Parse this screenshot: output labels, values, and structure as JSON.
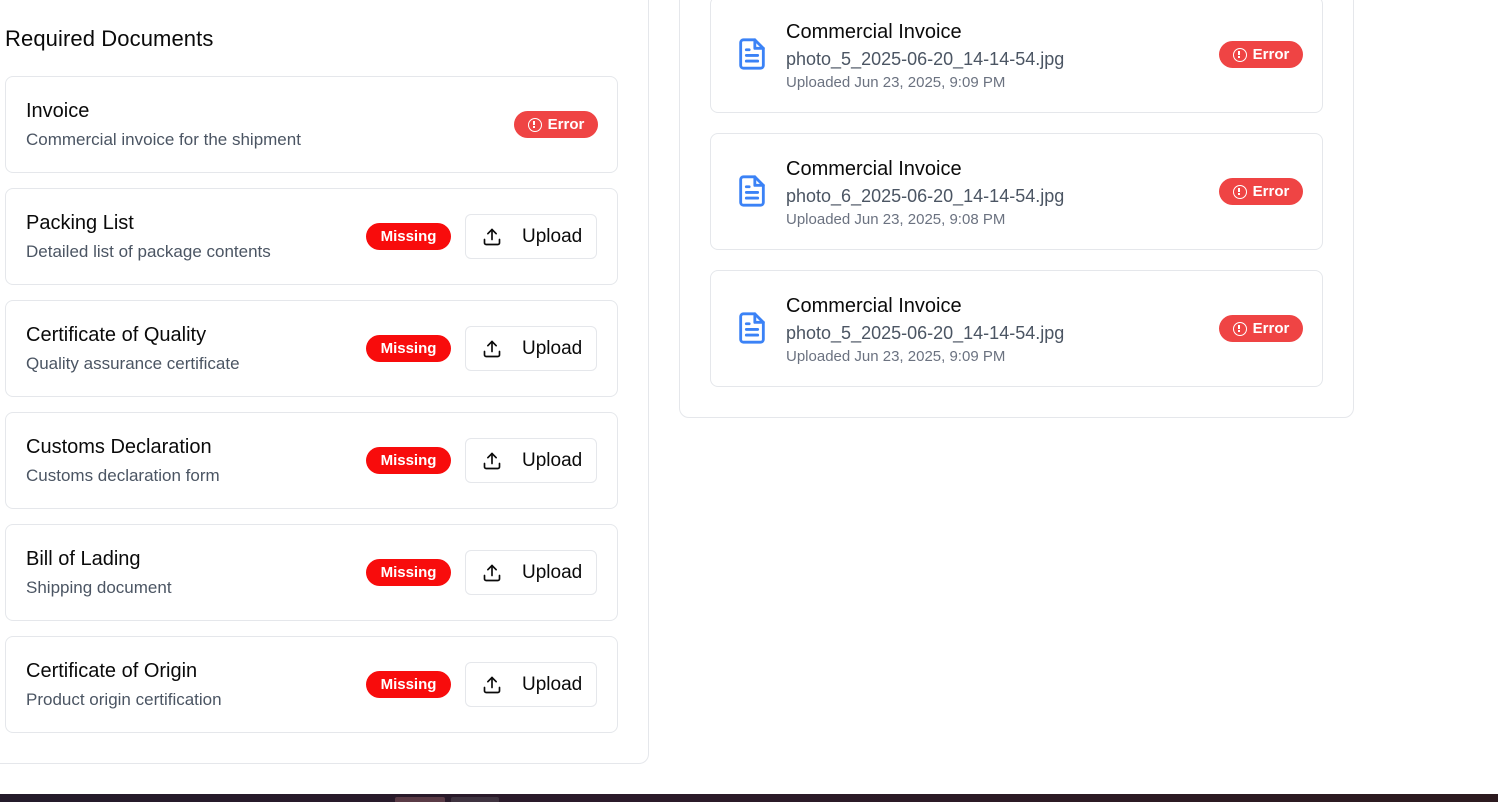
{
  "section_title": "Required Documents",
  "required_documents": [
    {
      "name": "Invoice",
      "description": "Commercial invoice for the shipment",
      "status": "Error",
      "has_upload": false
    },
    {
      "name": "Packing List",
      "description": "Detailed list of package contents",
      "status": "Missing",
      "upload_label": "Upload",
      "has_upload": true
    },
    {
      "name": "Certificate of Quality",
      "description": "Quality assurance certificate",
      "status": "Missing",
      "upload_label": "Upload",
      "has_upload": true
    },
    {
      "name": "Customs Declaration",
      "description": "Customs declaration form",
      "status": "Missing",
      "upload_label": "Upload",
      "has_upload": true
    },
    {
      "name": "Bill of Lading",
      "description": "Shipping document",
      "status": "Missing",
      "upload_label": "Upload",
      "has_upload": true
    },
    {
      "name": "Certificate of Origin",
      "description": "Product origin certification",
      "status": "Missing",
      "upload_label": "Upload",
      "has_upload": true
    }
  ],
  "uploaded_files": [
    {
      "title": "Commercial Invoice",
      "filename": "photo_5_2025-06-20_14-14-54.jpg",
      "uploaded": "Uploaded Jun 23, 2025, 9:09 PM",
      "status": "Error"
    },
    {
      "title": "Commercial Invoice",
      "filename": "photo_6_2025-06-20_14-14-54.jpg",
      "uploaded": "Uploaded Jun 23, 2025, 9:08 PM",
      "status": "Error"
    },
    {
      "title": "Commercial Invoice",
      "filename": "photo_5_2025-06-20_14-14-54.jpg",
      "uploaded": "Uploaded Jun 23, 2025, 9:09 PM",
      "status": "Error"
    }
  ],
  "icons": {
    "upload": "upload-icon",
    "file": "file-text-icon",
    "error": "alert-circle-icon"
  },
  "colors": {
    "error_badge": "#ef4444",
    "missing_badge": "#f80c0c",
    "file_icon": "#3b82f6",
    "border": "#e5e7eb",
    "muted_text": "#4b5563"
  }
}
